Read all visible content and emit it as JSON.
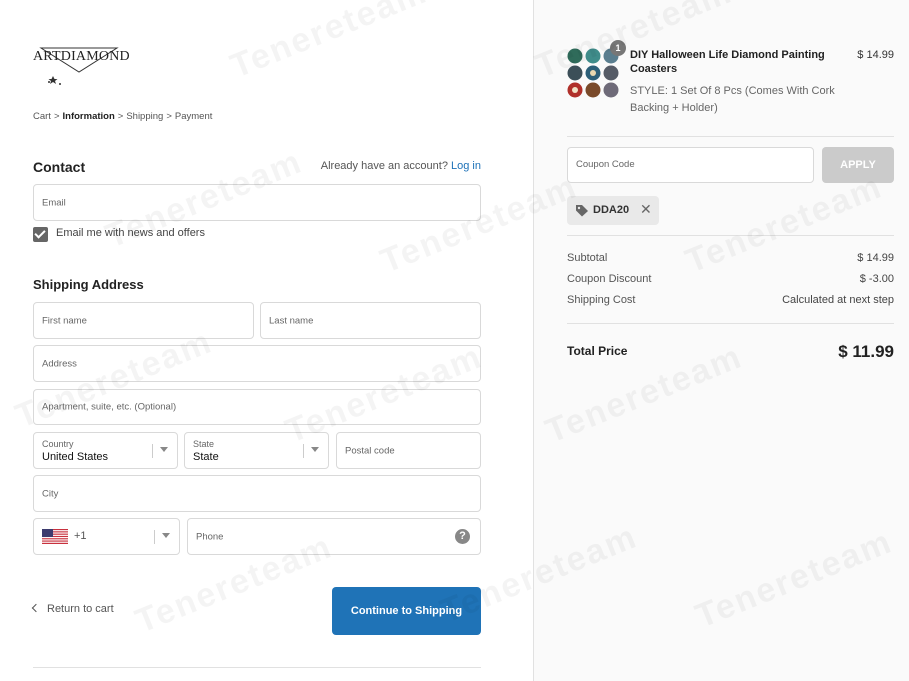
{
  "logo": {
    "text": "ARTDIAMOND"
  },
  "breadcrumb": [
    "Cart",
    "Information",
    "Shipping",
    "Payment"
  ],
  "breadcrumb_separator": ">",
  "contact": {
    "heading": "Contact",
    "account_prompt": "Already have an account?",
    "login_label": "Log in",
    "email_placeholder": "Email",
    "newsletter_label": "Email me with news and offers",
    "newsletter_checked": true
  },
  "shipping": {
    "heading": "Shipping Address",
    "first_name_placeholder": "First name",
    "last_name_placeholder": "Last name",
    "address_placeholder": "Address",
    "apartment_placeholder": "Apartment, suite, etc. (Optional)",
    "country_label": "Country",
    "country_value": "United States",
    "state_label": "State",
    "state_value": "State",
    "postal_placeholder": "Postal code",
    "city_placeholder": "City",
    "phone_code": "+1",
    "phone_placeholder": "Phone",
    "help_symbol": "?"
  },
  "footer": {
    "return_label": "Return to cart",
    "continue_label": "Continue to Shipping"
  },
  "order": {
    "quantity_badge": "1",
    "product_title": "DIY Halloween Life Diamond Painting Coasters",
    "product_style": "STYLE: 1 Set Of 8 Pcs (Comes With Cork Backing + Holder)",
    "product_price": "$ 14.99",
    "coupon_placeholder": "Coupon Code",
    "apply_label": "APPLY",
    "applied_code": "DDA20",
    "remove_symbol": "✕",
    "subtotal_label": "Subtotal",
    "subtotal_value": "$ 14.99",
    "discount_label": "Coupon Discount",
    "discount_value": "$ -3.00",
    "shipping_label": "Shipping Cost",
    "shipping_value": "Calculated at next step",
    "total_label": "Total Price",
    "total_value": "$ 11.99"
  },
  "watermark": {
    "text": "Tenereteam"
  },
  "colors": {
    "accent": "#1f73b7",
    "link": "#1e72b8",
    "apply_disabled": "#cbcbcb",
    "summary_bg": "#fafafa"
  }
}
